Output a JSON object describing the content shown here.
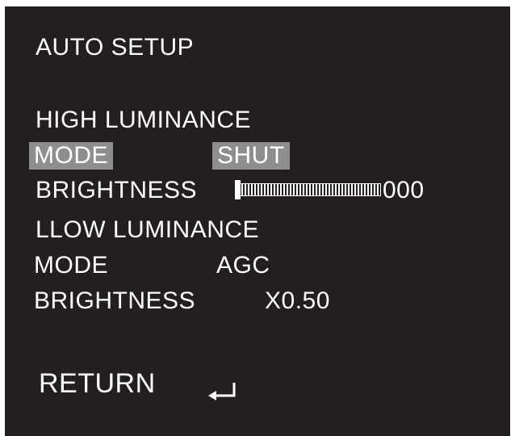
{
  "menu": {
    "title": "AUTO SETUP",
    "high_section": "HIGH LUMINANCE",
    "high_mode_label": "MODE",
    "high_mode_value": "SHUT",
    "high_brightness_label": "BRIGHTNESS",
    "high_brightness_value": "000",
    "high_brightness_level": 0,
    "low_section": "LLOW LUMINANCE",
    "low_mode_label": "MODE",
    "low_mode_value": "AGC",
    "low_brightness_label": "BRIGHTNESS",
    "low_brightness_value": "X0.50",
    "return_label": "RETURN",
    "return_icon": "enter-arrow-icon"
  },
  "colors": {
    "background": "#231f20",
    "text": "#ffffff",
    "highlight": "#8e8e8e"
  }
}
